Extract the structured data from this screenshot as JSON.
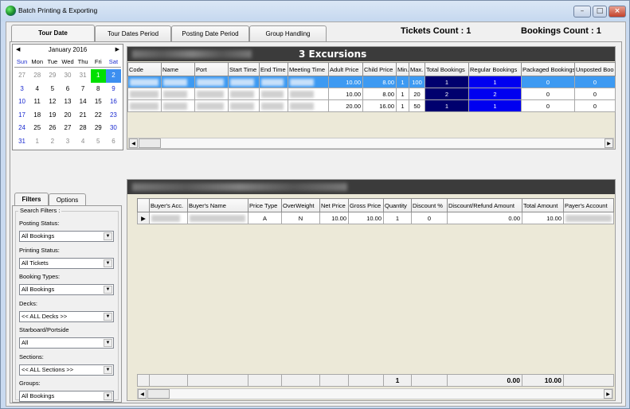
{
  "window": {
    "title": "Batch Printing & Exporting",
    "controls": {
      "minimize": "–",
      "maximize": "□",
      "close": "×"
    }
  },
  "tabs": [
    {
      "label": "Tour Date",
      "active": true
    },
    {
      "label": "Tour Dates Period",
      "active": false
    },
    {
      "label": "Posting Date Period",
      "active": false
    },
    {
      "label": "Group Handling",
      "active": false
    }
  ],
  "counts": {
    "tickets": "Tickets Count  : 1",
    "bookings": "Bookings Count : 1"
  },
  "calendar": {
    "month_label": "January 2016",
    "prev": "◀",
    "next": "▶",
    "days_of_week": [
      "Sun",
      "Mon",
      "Tue",
      "Wed",
      "Thu",
      "Fri",
      "Sat"
    ],
    "weeks": [
      [
        "27",
        "28",
        "29",
        "30",
        "31",
        "1",
        "2"
      ],
      [
        "3",
        "4",
        "5",
        "6",
        "7",
        "8",
        "9"
      ],
      [
        "10",
        "11",
        "12",
        "13",
        "14",
        "15",
        "16"
      ],
      [
        "17",
        "18",
        "19",
        "20",
        "21",
        "22",
        "23"
      ],
      [
        "24",
        "25",
        "26",
        "27",
        "28",
        "29",
        "30"
      ],
      [
        "31",
        "1",
        "2",
        "3",
        "4",
        "5",
        "6"
      ]
    ],
    "today": "1",
    "selected": "2",
    "today_color": "#00e000",
    "selected_color": "#3d8ff0"
  },
  "excursions": {
    "banner": "3 Excursions",
    "columns": [
      "Code",
      "Name",
      "Port",
      "Start Time",
      "End Time",
      "Meeting Time",
      "Adult Price",
      "Child Price",
      "Min.",
      "Max.",
      "Total Bookings",
      "Regular Bookings",
      "Packaged Bookings",
      "Unposted Boo"
    ],
    "rows": [
      {
        "adult_price": "10.00",
        "child_price": "8.00",
        "min": "1",
        "max": "100",
        "total": "1",
        "regular": "1",
        "packaged": "0",
        "unposted": "0",
        "selected": true
      },
      {
        "adult_price": "10.00",
        "child_price": "8.00",
        "min": "1",
        "max": "20",
        "total": "2",
        "regular": "2",
        "packaged": "0",
        "unposted": "0",
        "selected": false
      },
      {
        "adult_price": "20.00",
        "child_price": "16.00",
        "min": "1",
        "max": "50",
        "total": "1",
        "regular": "1",
        "packaged": "0",
        "unposted": "0",
        "selected": false
      }
    ],
    "colors": {
      "total_bg": "#00006e",
      "regular_bg": "#0000f0",
      "selected_row": "#3d9af2"
    }
  },
  "filters": {
    "tabs": [
      {
        "label": "Filters",
        "active": true
      },
      {
        "label": "Options",
        "active": false
      }
    ],
    "group_title": "Search Filters :",
    "fields": [
      {
        "label": "Posting Status:",
        "value": "All Bookings"
      },
      {
        "label": "Printing Status:",
        "value": "All Tickets"
      },
      {
        "label": "Booking Types:",
        "value": "All Bookings"
      },
      {
        "label": "Decks:",
        "value": "<< ALL Decks >>"
      },
      {
        "label": "Starboard/Portside",
        "value": "All"
      },
      {
        "label": "Sections:",
        "value": "<< ALL Sections >>"
      },
      {
        "label": "Groups:",
        "value": "All Bookings"
      }
    ]
  },
  "bookings": {
    "columns": [
      "",
      "Buyer's Acc.",
      "Buyer's Name",
      "Price Type",
      "OverWeight",
      "Net Price",
      "Gross Price",
      "Quantity",
      "Discount %",
      "Discount/Refund Amount",
      "Total Amount",
      "Payer's Account"
    ],
    "rows": [
      {
        "price_type": "A",
        "overweight": "N",
        "net_price": "10.00",
        "gross_price": "10.00",
        "quantity": "1",
        "discount_pct": "0",
        "discount_amount": "0.00",
        "total_amount": "10.00"
      }
    ],
    "totals": {
      "quantity": "1",
      "discount_amount": "0.00",
      "total_amount": "10.00"
    }
  }
}
